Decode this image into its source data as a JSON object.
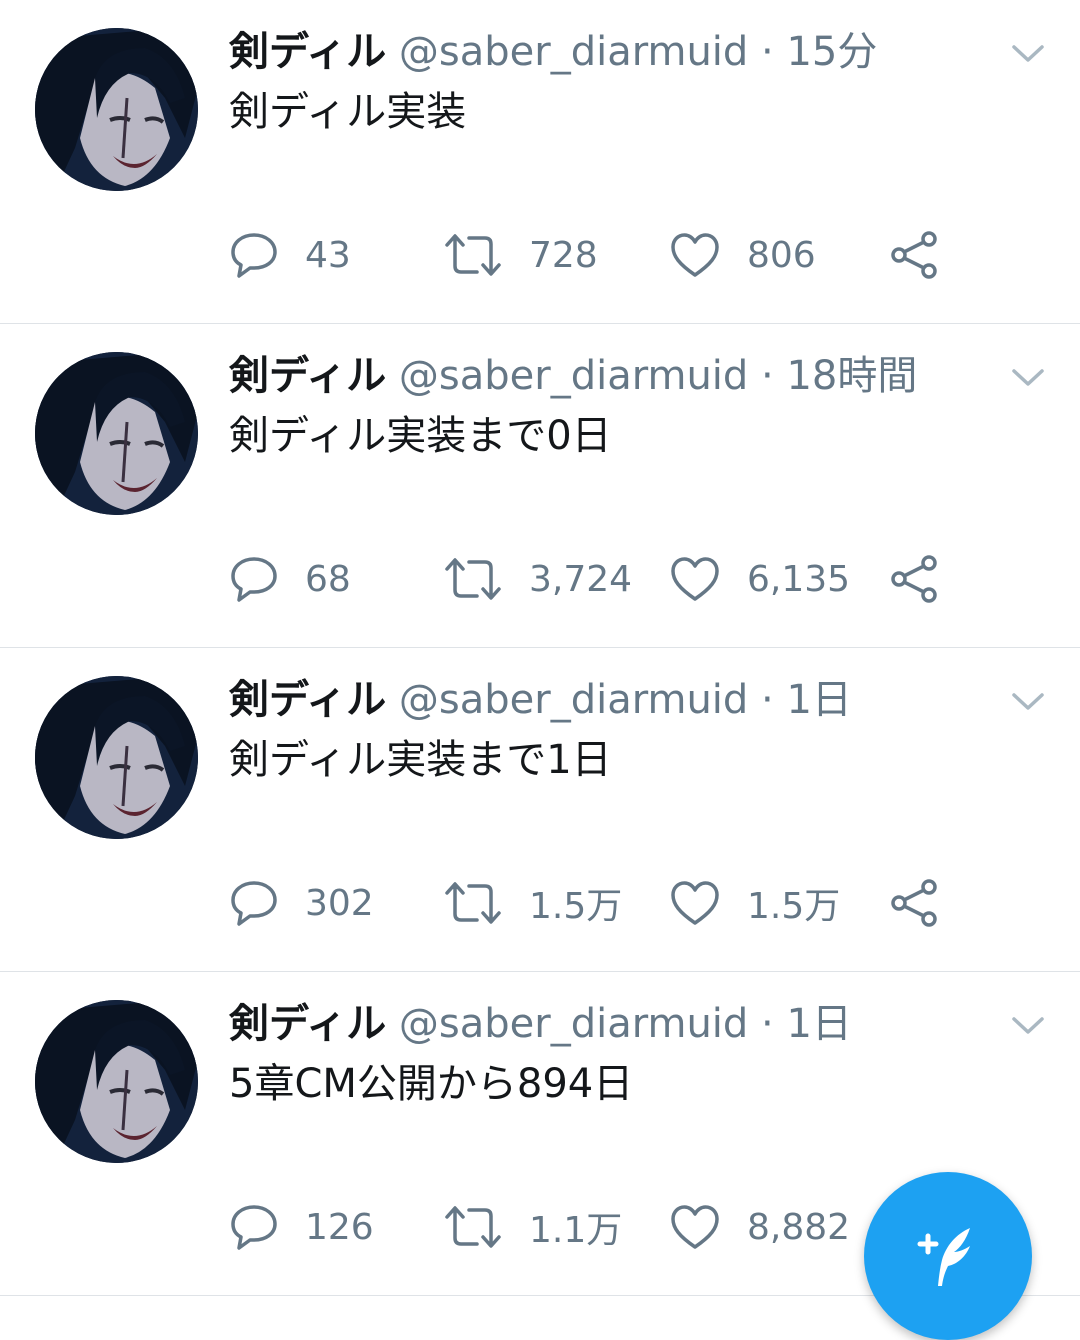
{
  "tweets": [
    {
      "name": "剣ディル",
      "handle": "@saber_diarmuid",
      "separator": "·",
      "time": "15分",
      "text": "剣ディル実装",
      "replies": "43",
      "retweets": "728",
      "likes": "806"
    },
    {
      "name": "剣ディル",
      "handle": "@saber_diarmuid",
      "separator": "·",
      "time": "18時間",
      "text": "剣ディル実装まで0日",
      "replies": "68",
      "retweets": "3,724",
      "likes": "6,135"
    },
    {
      "name": "剣ディル",
      "handle": "@saber_diarmuid",
      "separator": "·",
      "time": "1日",
      "text": "剣ディル実装まで1日",
      "replies": "302",
      "retweets": "1.5万",
      "likes": "1.5万"
    },
    {
      "name": "剣ディル",
      "handle": "@saber_diarmuid",
      "separator": "·",
      "time": "1日",
      "text": "5章CM公開から894日",
      "replies": "126",
      "retweets": "1.1万",
      "likes": "8,882"
    }
  ],
  "icons": {
    "reply": "speech-bubble-icon",
    "retweet": "retweet-icon",
    "like": "heart-icon",
    "share": "share-icon",
    "menu": "chevron-down-icon",
    "compose": "compose-feather-icon"
  },
  "colors": {
    "accent": "#1da1f2",
    "secondary_text": "#657786",
    "primary_text": "#14171a",
    "divider": "#dfe3e7"
  }
}
